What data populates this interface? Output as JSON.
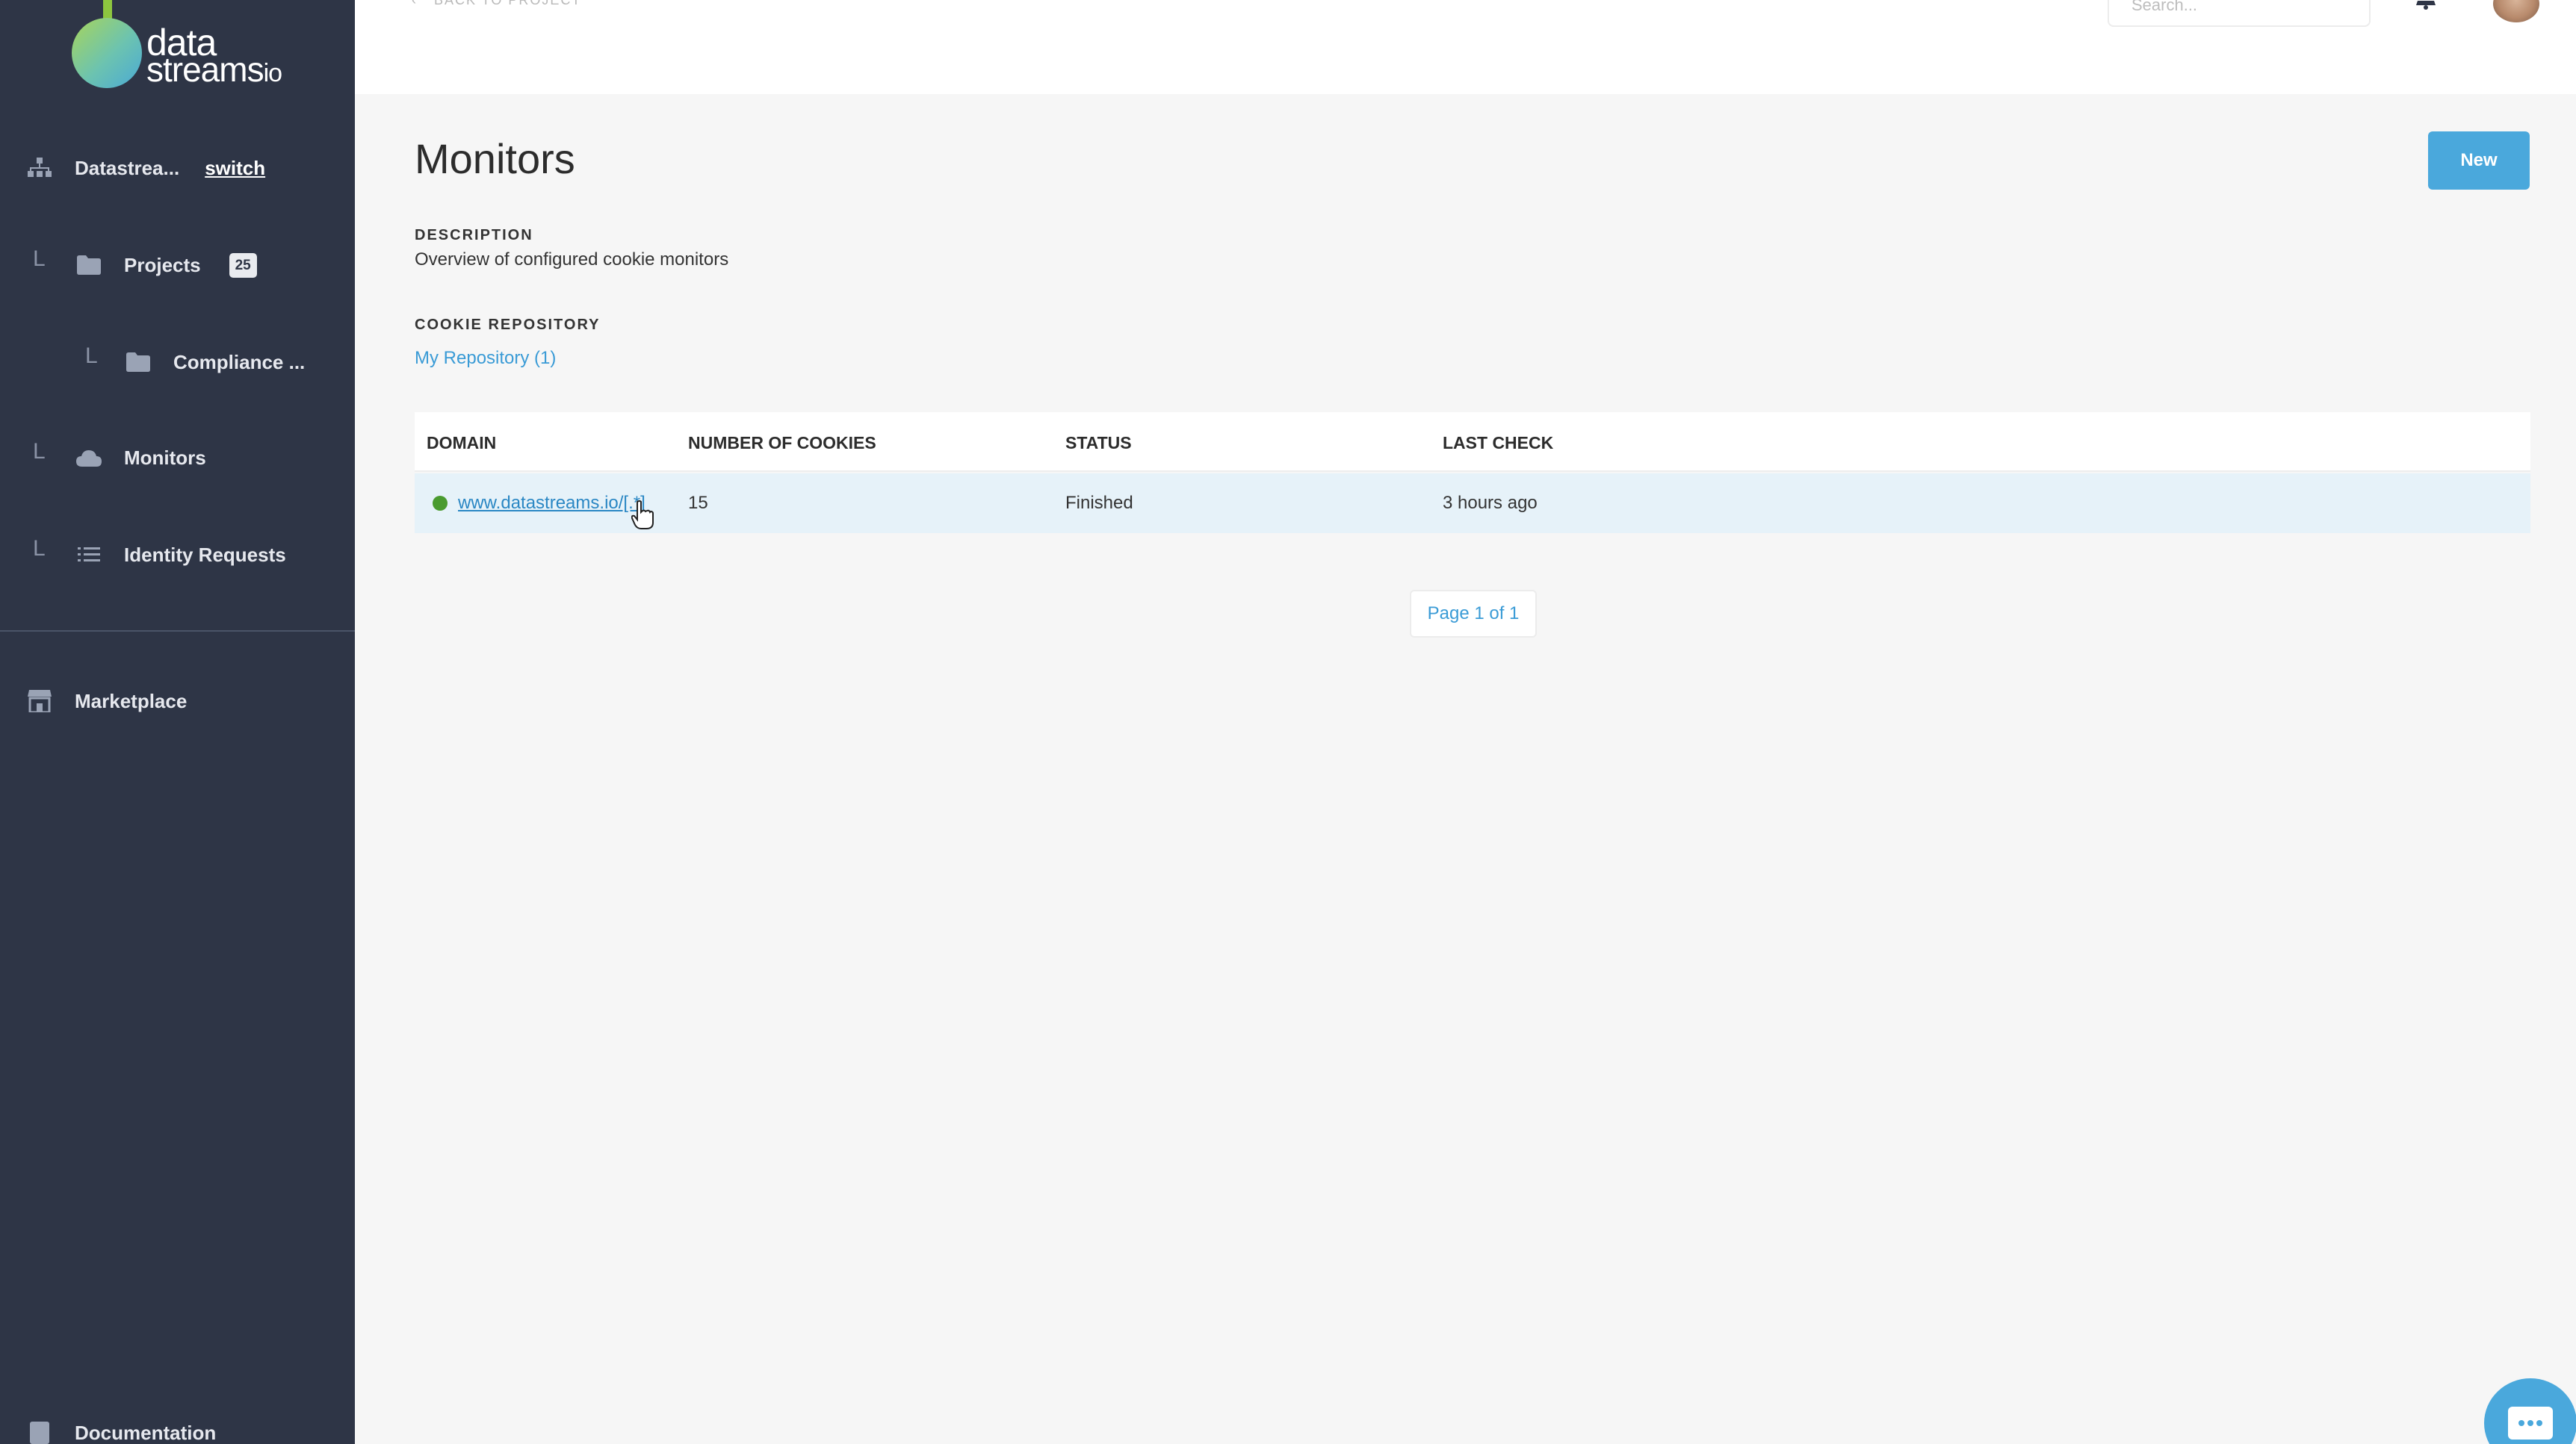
{
  "brand": {
    "logo_line1": "data",
    "logo_line2": "streams",
    "logo_suffix": "io",
    "accent_color": "#4aa8dc",
    "sidebar_color": "#2e3546"
  },
  "sidebar": {
    "org": {
      "label": "Datastrea...",
      "switch_label": "switch",
      "icon": "sitemap-icon"
    },
    "items": [
      {
        "label": "Projects",
        "badge": "25",
        "icon": "folder-icon"
      },
      {
        "label": "Compliance ...",
        "icon": "folder-icon"
      },
      {
        "label": "Monitors",
        "icon": "cloud-icon"
      },
      {
        "label": "Identity Requests",
        "icon": "list-icon"
      },
      {
        "label": "Marketplace",
        "icon": "store-icon"
      },
      {
        "label": "Documentation",
        "icon": "book-icon"
      }
    ],
    "tree_marker": "L"
  },
  "topbar": {
    "back_label": "BACK TO PROJECT",
    "search_placeholder": "Search..."
  },
  "main": {
    "title": "Monitors",
    "new_button": "New",
    "description_label": "DESCRIPTION",
    "description_text": "Overview of configured cookie monitors",
    "repository_label": "COOKIE REPOSITORY",
    "repository_link": "My Repository (1)",
    "table": {
      "columns": [
        "DOMAIN",
        "NUMBER OF COOKIES",
        "STATUS",
        "LAST CHECK"
      ],
      "rows": [
        {
          "domain": "www.datastreams.io/[.*]",
          "cookies": "15",
          "status": "Finished",
          "last_check": "3 hours ago",
          "status_color": "#4a9b2f"
        }
      ]
    },
    "pagination": "Page 1 of 1"
  }
}
